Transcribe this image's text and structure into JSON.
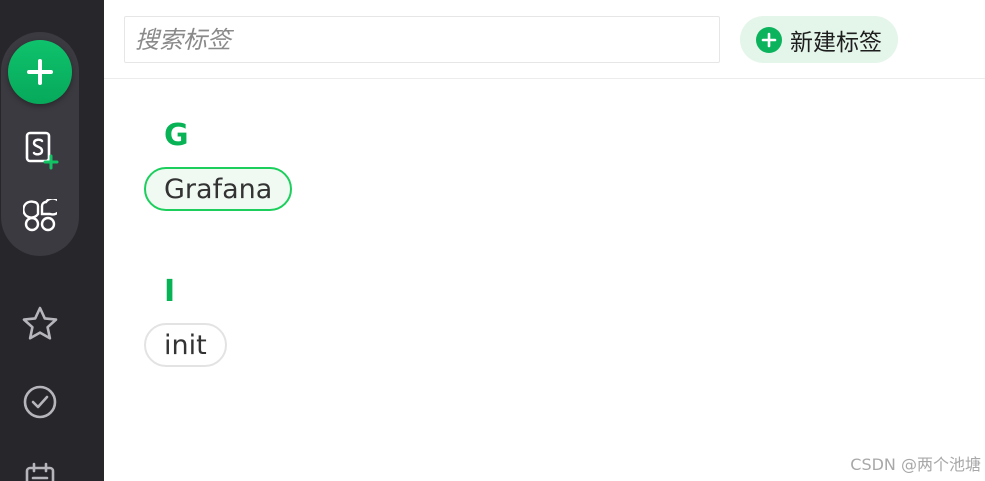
{
  "search": {
    "placeholder": "搜索标签",
    "value": ""
  },
  "toolbar": {
    "new_tag_label": "新建标签"
  },
  "sidebar": {
    "items": [
      {
        "name": "add",
        "icon": "plus-icon"
      },
      {
        "name": "new-note",
        "icon": "note-add-icon"
      },
      {
        "name": "apps",
        "icon": "grid-icon"
      },
      {
        "name": "favorites",
        "icon": "star-icon"
      },
      {
        "name": "tasks",
        "icon": "check-circle-icon"
      },
      {
        "name": "calendar",
        "icon": "calendar-icon"
      }
    ]
  },
  "tag_groups": [
    {
      "letter": "G",
      "tags": [
        "Grafana"
      ]
    },
    {
      "letter": "I",
      "tags": [
        "init"
      ]
    }
  ],
  "watermark": "CSDN @两个池塘",
  "colors": {
    "accent": "#08b356",
    "sidebar_bg": "#26262b",
    "sidebar_group_bg": "#3a3a40",
    "new_tag_bg": "#e4f5ea"
  }
}
